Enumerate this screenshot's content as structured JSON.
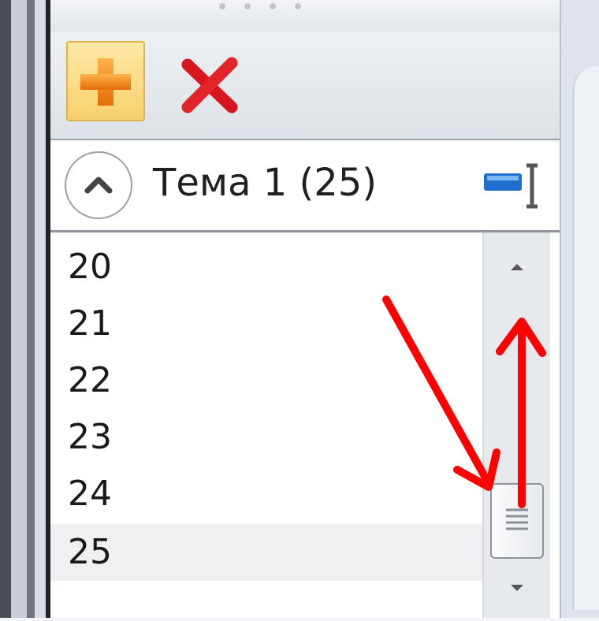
{
  "group": {
    "title": "Тема 1 (25)"
  },
  "list": {
    "items": [
      "20",
      "21",
      "22",
      "23",
      "24",
      "25"
    ],
    "selected_index": 5
  },
  "icons": {
    "add": "plus-icon",
    "delete": "x-icon",
    "collapse": "chevron-up-icon",
    "column_chooser": "column-chooser-icon",
    "scroll_up": "triangle-up-icon",
    "scroll_down": "triangle-down-icon",
    "grip": "grip-lines-icon"
  },
  "colors": {
    "add_accent": "#f28c1a",
    "delete_accent": "#d8161d",
    "annotation_arrow": "#ff0000",
    "selected_row": "#eef0f2"
  }
}
